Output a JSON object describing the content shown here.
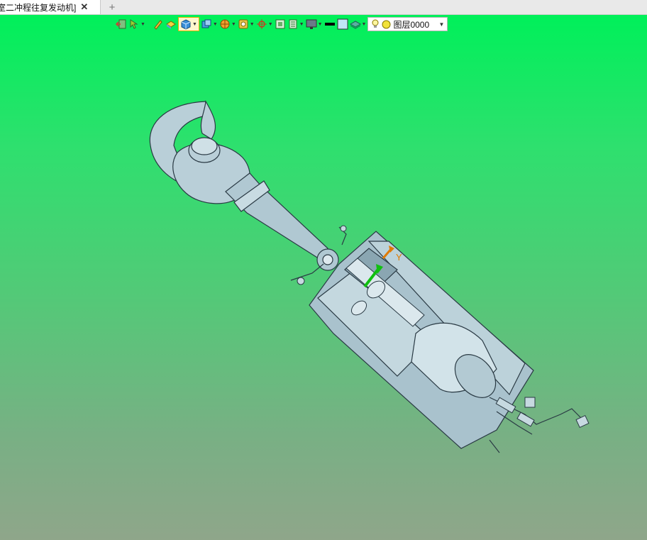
{
  "tab": {
    "title": "室二冲程往复发动机]",
    "close": "✕",
    "add": "+"
  },
  "toolbar": {
    "layer_value": "图层0000",
    "dropdown_arrow": "▼"
  },
  "viewport": {
    "axis_label": "Y"
  },
  "colors": {
    "background_top": "#00f05a",
    "background_bottom": "#8fa68a",
    "model_fill": "#b9cfd8",
    "model_stroke": "#2a3a44"
  }
}
